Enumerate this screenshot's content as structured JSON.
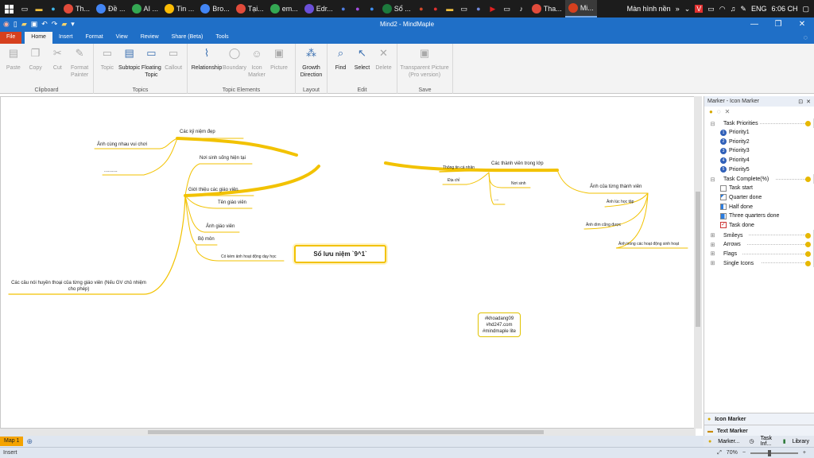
{
  "taskbar": {
    "apps": [
      {
        "label": "Th...",
        "color": "#e14b3b"
      },
      {
        "label": "Đề ...",
        "color": "#4285f4"
      },
      {
        "label": "AI ...",
        "color": "#34a853"
      },
      {
        "label": "Tin ...",
        "color": "#fbbc05"
      },
      {
        "label": "Bro...",
        "color": "#4285f4"
      },
      {
        "label": "Tại...",
        "color": "#e14b3b"
      },
      {
        "label": "em...",
        "color": "#34a853"
      },
      {
        "label": "Edr...",
        "color": "#6b4fd8"
      },
      {
        "label": "Sổ ...",
        "color": "#1d7a3d"
      },
      {
        "label": "Tha...",
        "color": "#e14b3b"
      },
      {
        "label": "Mi...",
        "color": "#d6401e"
      }
    ],
    "desktop_label": "Màn hình nền",
    "chevron": "»",
    "lang": "ENG",
    "clock": "6:06 CH"
  },
  "window": {
    "title": "Mind2 - MindMaple"
  },
  "menu_tabs": [
    "File",
    "Home",
    "Insert",
    "Format",
    "View",
    "Review",
    "Share (Beta)",
    "Tools"
  ],
  "ribbon": {
    "clipboard": {
      "label": "Clipboard",
      "paste": "Paste",
      "copy": "Copy",
      "cut": "Cut",
      "format_painter": "Format Painter"
    },
    "topics": {
      "label": "Topics",
      "topic": "Topic",
      "subtopic": "Subtopic",
      "floating": "Floating Topic",
      "callout": "Callout"
    },
    "topic_elements": {
      "label": "Topic Elements",
      "relationship": "Relationship",
      "boundary": "Boundary",
      "icon_marker": "Icon Marker",
      "picture": "Picture"
    },
    "layout": {
      "label": "Layout",
      "growth": "Growth Direction"
    },
    "edit": {
      "label": "Edit",
      "find": "Find",
      "select": "Select",
      "delete": "Delete"
    },
    "save": {
      "label": "Save",
      "transparent": "Transparent Picture (Pro version)"
    }
  },
  "mindmap": {
    "central": "Sổ lưu niệm `9^1`",
    "nodes": {
      "memories": "Các kỷ niệm đẹp",
      "photos_play": "Ảnh cùng nhau vui chơi",
      "dots1": "..........",
      "teachers": "Giới thiệu các giáo viên",
      "teacher_home": "Nơi sinh sống hiện tại",
      "teacher_name": "Tên giáo viên",
      "teacher_photo": "Ảnh giáo viên",
      "subject": "Bộ môn",
      "teaching_photos": "Có kèm ảnh hoạt động dạy học",
      "quotes": "Các câu nói huyền thoại của từng giáo viên (Nếu GV chủ nhiệm cho phép)",
      "class_members": "Các thành viên trong lớp",
      "personal_info": "Thông tin cá nhân",
      "address": "Địa chỉ",
      "birthplace": "Nơi sinh",
      "dots2": "....",
      "member_photos": "Ảnh của từng thành viên",
      "young_photo": "Ảnh lúc học tập",
      "fun_photo": "Ảnh dìm cũng được",
      "activity_photo": "Ảnh trong các hoạt động sinh hoạt"
    },
    "floating": [
      "#khoadang09",
      "#hd247.com",
      "#mindmaple lite"
    ]
  },
  "panel": {
    "title": "Marker - Icon Marker",
    "groups": {
      "task_priorities": "Task Priorities",
      "priorities": [
        "Priority1",
        "Priority2",
        "Priority3",
        "Priority4",
        "Priority5"
      ],
      "task_complete": "Task Complete(%)",
      "completes": [
        "Task start",
        "Quarter done",
        "Half done",
        "Three quarters done",
        "Task done"
      ],
      "others": [
        "Smileys",
        "Arrows",
        "Flags",
        "Single Icons"
      ]
    },
    "bottom_tabs": [
      "Icon Marker",
      "Text Marker"
    ],
    "dock_tabs": [
      "Marker...",
      "Task Inf...",
      "Library"
    ]
  },
  "sheet_tab": "Map 1",
  "status": {
    "mode": "Insert",
    "zoom": "70%"
  },
  "colors": {
    "branch": "#f2c200",
    "titlebar": "#1f6fc7",
    "file_tab": "#d6401e"
  }
}
